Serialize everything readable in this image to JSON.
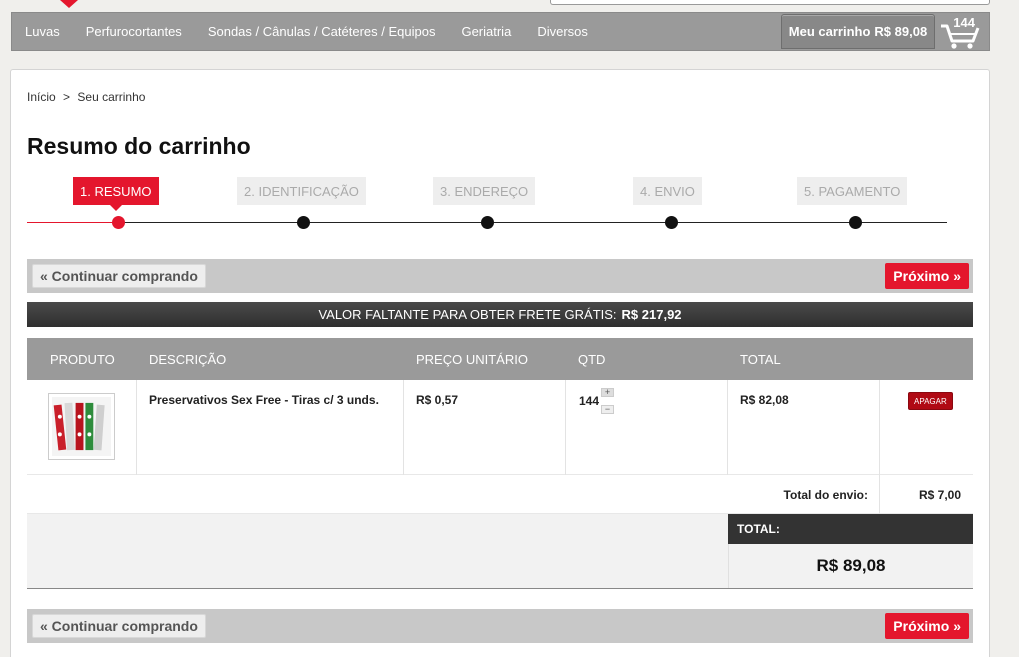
{
  "nav": {
    "items": [
      "Luvas",
      "Perfurocortantes",
      "Sondas / Cânulas / Catéteres / Equipos",
      "Geriatria",
      "Diversos"
    ],
    "cart_label": "Meu carrinho",
    "cart_total": "R$ 89,08",
    "cart_count": "144",
    "cart_icon": "shopping-cart-icon"
  },
  "breadcrumb": {
    "home": "Início",
    "separator": ">",
    "current": "Seu carrinho"
  },
  "page": {
    "title": "Resumo do carrinho"
  },
  "steps": [
    {
      "label": "1. RESUMO",
      "active": true
    },
    {
      "label": "2. IDENTIFICAÇÃO",
      "active": false
    },
    {
      "label": "3. ENDEREÇO",
      "active": false
    },
    {
      "label": "4. ENVIO",
      "active": false
    },
    {
      "label": "5. PAGAMENTO",
      "active": false
    }
  ],
  "actions": {
    "continue_label": "« Continuar comprando",
    "next_label": "Próximo »"
  },
  "free_shipping": {
    "label": "VALOR FALTANTE PARA OBTER FRETE GRÁTIS:",
    "value": "R$ 217,92"
  },
  "table": {
    "headers": {
      "product": "PRODUTO",
      "description": "DESCRIÇÃO",
      "unit_price": "PREÇO UNITÁRIO",
      "qty": "QTD",
      "total": "TOTAL"
    },
    "rows": [
      {
        "description": "Preservativos Sex Free - Tiras c/ 3 unds.",
        "unit_price": "R$ 0,57",
        "qty": "144",
        "total": "R$ 82,08",
        "delete_label": "APAGAR",
        "plus": "+",
        "minus": "−"
      }
    ]
  },
  "shipping": {
    "label": "Total do envio:",
    "value": "R$ 7,00"
  },
  "order_total": {
    "label": "TOTAL:",
    "value": "R$ 89,08"
  },
  "colors": {
    "accent": "#e4162d",
    "nav_bg": "#9a9a9a",
    "dark": "#333333"
  }
}
